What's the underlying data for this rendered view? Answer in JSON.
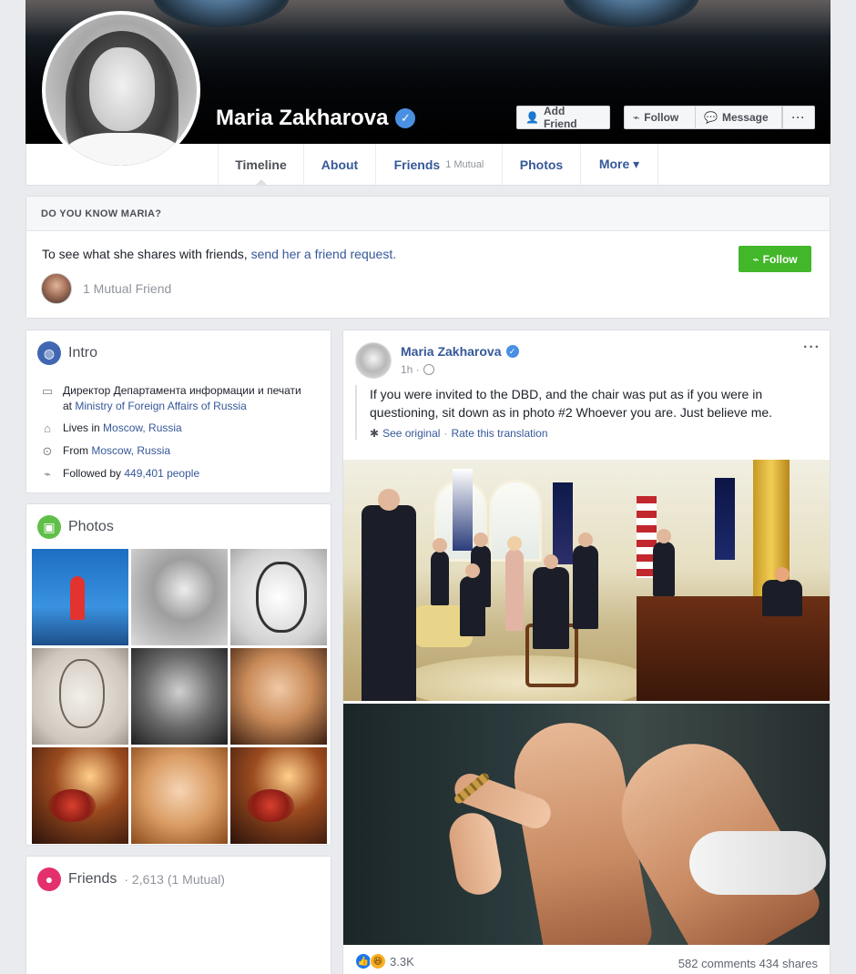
{
  "profile": {
    "name": "Maria Zakharova",
    "verified_mark": "✓"
  },
  "cover_buttons": {
    "add_friend": "Add Friend",
    "follow": "Follow",
    "message": "Message",
    "more": "···"
  },
  "nav": {
    "tabs": [
      {
        "label": "Timeline",
        "sub": ""
      },
      {
        "label": "About",
        "sub": ""
      },
      {
        "label": "Friends",
        "sub": "1 Mutual"
      },
      {
        "label": "Photos",
        "sub": ""
      },
      {
        "label": "More ▾",
        "sub": ""
      }
    ]
  },
  "know": {
    "heading": "DO YOU KNOW MARIA?",
    "text": "To see what she shares with friends, ",
    "link": "send her a friend request.",
    "follow": "Follow",
    "mutual": "1 Mutual Friend"
  },
  "intro": {
    "title": "Intro",
    "job_text": "Директор Департамента информации и печати at ",
    "job_link": "Ministry of Foreign Affairs of Russia",
    "lives_text": "Lives in ",
    "lives_link": "Moscow, Russia",
    "from_text": "From ",
    "from_link": "Moscow, Russia",
    "followed_text": "Followed by ",
    "followed_link": "449,401 people"
  },
  "photos": {
    "title": "Photos"
  },
  "friends": {
    "title": "Friends",
    "sub": "· 2,613 (1 Mutual)"
  },
  "post": {
    "author": "Maria Zakharova",
    "time": "1h ·",
    "text": "If you were invited to the DBD, and the chair was put as if you were in questioning, sit down as in photo #2 Whoever you are. Just believe me.",
    "see_original": "See original",
    "separator": "·",
    "rate_translation": "Rate this translation",
    "reaction_count": "3.3K",
    "stats": "582 comments  434 shares",
    "more": "···"
  },
  "colors": {
    "link": "#365899",
    "green": "#42b72a",
    "background": "#e9ebee"
  },
  "icons": {
    "intro": "globe-icon",
    "photos": "photo-icon",
    "friends": "people-icon"
  }
}
